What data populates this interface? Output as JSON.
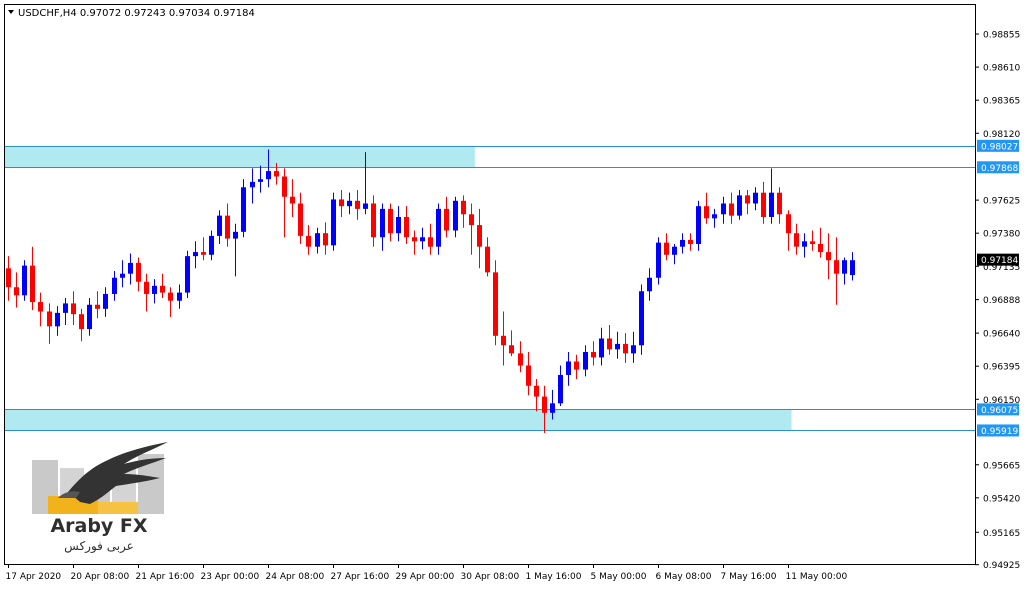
{
  "chart_data": {
    "type": "candlestick",
    "symbol_line": "USDCHF,H4  0.97072 0.97243 0.97034 0.97184",
    "menu_icon": "triangle-down-icon",
    "ylim": [
      0.9493,
      0.9907
    ],
    "y_ticks": [
      "0.98855",
      "0.98610",
      "0.98365",
      "0.98120",
      "0.97625",
      "0.97380",
      "0.97135",
      "0.96888",
      "0.96640",
      "0.96395",
      "0.96150",
      "0.95665",
      "0.95420",
      "0.95165",
      "0.94925"
    ],
    "x_ticks": [
      "17 Apr 2020",
      "20 Apr 08:00",
      "21 Apr 16:00",
      "23 Apr 00:00",
      "24 Apr 08:00",
      "27 Apr 16:00",
      "29 Apr 00:00",
      "30 Apr 08:00",
      "1 May 16:00",
      "5 May 00:00",
      "6 May 08:00",
      "7 May 16:00",
      "11 May 00:00"
    ],
    "x_tick_bar_index": [
      0,
      8,
      16,
      24,
      32,
      40,
      48,
      56,
      64,
      72,
      80,
      88,
      96
    ],
    "grid": false,
    "colors": {
      "bull": "#0000ff",
      "bear": "#ff0000",
      "zone": "#b0eaf0",
      "zone_line": "#2e8fc4",
      "price_label_bg": "#2196f3",
      "current_label_bg": "#000000"
    },
    "zones": [
      {
        "from": 0.97868,
        "to": 0.98027,
        "start_bar": 0,
        "end_bar": 57
      },
      {
        "from": 0.95919,
        "to": 0.96075,
        "start_bar": 0,
        "end_bar": 96
      }
    ],
    "level_labels": [
      {
        "value": 0.98027,
        "label": "0.98027"
      },
      {
        "value": 0.97868,
        "label": "0.97868"
      },
      {
        "value": 0.96075,
        "label": "0.96075"
      },
      {
        "value": 0.95919,
        "label": "0.95919"
      }
    ],
    "current_price": {
      "value": 0.97184,
      "label": "0.97184"
    },
    "candles": [
      [
        0.9712,
        0.9721,
        0.9688,
        0.9698
      ],
      [
        0.9698,
        0.9709,
        0.9683,
        0.9692
      ],
      [
        0.9692,
        0.9718,
        0.9688,
        0.9714
      ],
      [
        0.9714,
        0.9728,
        0.9681,
        0.9687
      ],
      [
        0.9687,
        0.9694,
        0.9669,
        0.968
      ],
      [
        0.968,
        0.9686,
        0.9656,
        0.9669
      ],
      [
        0.9669,
        0.9684,
        0.9662,
        0.9679
      ],
      [
        0.9679,
        0.969,
        0.967,
        0.9686
      ],
      [
        0.9686,
        0.9695,
        0.967,
        0.9678
      ],
      [
        0.9678,
        0.9682,
        0.9658,
        0.9667
      ],
      [
        0.9667,
        0.969,
        0.9662,
        0.9685
      ],
      [
        0.9685,
        0.9695,
        0.9675,
        0.9682
      ],
      [
        0.9682,
        0.9698,
        0.9676,
        0.9693
      ],
      [
        0.9693,
        0.971,
        0.9688,
        0.9705
      ],
      [
        0.9705,
        0.9718,
        0.9698,
        0.9708
      ],
      [
        0.9708,
        0.9723,
        0.97,
        0.9716
      ],
      [
        0.9716,
        0.972,
        0.9695,
        0.9702
      ],
      [
        0.9702,
        0.9708,
        0.968,
        0.9693
      ],
      [
        0.9693,
        0.9704,
        0.9686,
        0.9699
      ],
      [
        0.9699,
        0.9708,
        0.969,
        0.9694
      ],
      [
        0.9694,
        0.9698,
        0.9676,
        0.9688
      ],
      [
        0.9688,
        0.97,
        0.9682,
        0.9694
      ],
      [
        0.9694,
        0.9725,
        0.969,
        0.9721
      ],
      [
        0.9721,
        0.9732,
        0.9712,
        0.9724
      ],
      [
        0.9724,
        0.9735,
        0.9718,
        0.9722
      ],
      [
        0.9722,
        0.974,
        0.9718,
        0.9736
      ],
      [
        0.9736,
        0.9755,
        0.973,
        0.9751
      ],
      [
        0.9751,
        0.976,
        0.9728,
        0.9734
      ],
      [
        0.9734,
        0.9745,
        0.9706,
        0.9739
      ],
      [
        0.9739,
        0.9778,
        0.9735,
        0.9772
      ],
      [
        0.9772,
        0.9786,
        0.976,
        0.9776
      ],
      [
        0.9776,
        0.9788,
        0.9768,
        0.9778
      ],
      [
        0.9778,
        0.98,
        0.9772,
        0.9784
      ],
      [
        0.9784,
        0.979,
        0.9774,
        0.978
      ],
      [
        0.978,
        0.9786,
        0.9735,
        0.9765
      ],
      [
        0.9765,
        0.9778,
        0.975,
        0.976
      ],
      [
        0.976,
        0.9768,
        0.973,
        0.9736
      ],
      [
        0.9736,
        0.9744,
        0.9722,
        0.9728
      ],
      [
        0.9728,
        0.9742,
        0.9723,
        0.9738
      ],
      [
        0.9738,
        0.9746,
        0.9722,
        0.9729
      ],
      [
        0.9729,
        0.9768,
        0.9725,
        0.9763
      ],
      [
        0.9763,
        0.977,
        0.975,
        0.9758
      ],
      [
        0.9758,
        0.9768,
        0.9752,
        0.9762
      ],
      [
        0.9762,
        0.977,
        0.9748,
        0.9756
      ],
      [
        0.9756,
        0.9798,
        0.9752,
        0.976
      ],
      [
        0.976,
        0.9766,
        0.9728,
        0.9735
      ],
      [
        0.9735,
        0.976,
        0.9725,
        0.9756
      ],
      [
        0.9756,
        0.976,
        0.9732,
        0.9738
      ],
      [
        0.9738,
        0.9758,
        0.9732,
        0.975
      ],
      [
        0.975,
        0.9758,
        0.973,
        0.9735
      ],
      [
        0.9735,
        0.974,
        0.9722,
        0.9732
      ],
      [
        0.9732,
        0.9742,
        0.9726,
        0.9735
      ],
      [
        0.9735,
        0.9745,
        0.9722,
        0.9728
      ],
      [
        0.9728,
        0.976,
        0.9722,
        0.9756
      ],
      [
        0.9756,
        0.9765,
        0.9735,
        0.974
      ],
      [
        0.974,
        0.9765,
        0.9735,
        0.9762
      ],
      [
        0.9762,
        0.9766,
        0.9742,
        0.9752
      ],
      [
        0.9752,
        0.976,
        0.9722,
        0.9744
      ],
      [
        0.9744,
        0.9756,
        0.9712,
        0.9728
      ],
      [
        0.9728,
        0.9735,
        0.9706,
        0.9709
      ],
      [
        0.9709,
        0.9718,
        0.9655,
        0.9662
      ],
      [
        0.9662,
        0.968,
        0.964,
        0.9655
      ],
      [
        0.9655,
        0.9666,
        0.9647,
        0.9649
      ],
      [
        0.9649,
        0.9658,
        0.9635,
        0.964
      ],
      [
        0.964,
        0.965,
        0.9618,
        0.9625
      ],
      [
        0.9625,
        0.963,
        0.9606,
        0.9617
      ],
      [
        0.9617,
        0.9625,
        0.959,
        0.9605
      ],
      [
        0.9605,
        0.9622,
        0.96,
        0.9612
      ],
      [
        0.9612,
        0.964,
        0.961,
        0.9633
      ],
      [
        0.9633,
        0.965,
        0.9625,
        0.9643
      ],
      [
        0.9643,
        0.9648,
        0.963,
        0.9637
      ],
      [
        0.9637,
        0.9655,
        0.9632,
        0.965
      ],
      [
        0.965,
        0.9658,
        0.964,
        0.9646
      ],
      [
        0.9646,
        0.9668,
        0.964,
        0.966
      ],
      [
        0.966,
        0.967,
        0.9648,
        0.9652
      ],
      [
        0.9652,
        0.9665,
        0.9645,
        0.9656
      ],
      [
        0.9656,
        0.9664,
        0.9642,
        0.9649
      ],
      [
        0.9649,
        0.9665,
        0.9642,
        0.9655
      ],
      [
        0.9655,
        0.97,
        0.9648,
        0.9695
      ],
      [
        0.9695,
        0.9712,
        0.9688,
        0.9705
      ],
      [
        0.9705,
        0.9735,
        0.97,
        0.9731
      ],
      [
        0.9731,
        0.9738,
        0.9718,
        0.9722
      ],
      [
        0.9722,
        0.973,
        0.9715,
        0.9728
      ],
      [
        0.9728,
        0.9738,
        0.9723,
        0.9733
      ],
      [
        0.9733,
        0.9738,
        0.9725,
        0.973
      ],
      [
        0.973,
        0.9762,
        0.9725,
        0.9758
      ],
      [
        0.9758,
        0.9768,
        0.9745,
        0.9749
      ],
      [
        0.9749,
        0.9756,
        0.9742,
        0.9752
      ],
      [
        0.9752,
        0.9765,
        0.9745,
        0.976
      ],
      [
        0.976,
        0.9768,
        0.9745,
        0.9751
      ],
      [
        0.9751,
        0.977,
        0.9748,
        0.9766
      ],
      [
        0.9766,
        0.977,
        0.9752,
        0.976
      ],
      [
        0.976,
        0.9772,
        0.9755,
        0.9768
      ],
      [
        0.9768,
        0.9776,
        0.9745,
        0.975
      ],
      [
        0.975,
        0.9786,
        0.9745,
        0.9768
      ],
      [
        0.9768,
        0.9772,
        0.9745,
        0.9752
      ],
      [
        0.9752,
        0.9755,
        0.9725,
        0.9738
      ],
      [
        0.9738,
        0.9745,
        0.9722,
        0.9728
      ],
      [
        0.9728,
        0.9738,
        0.972,
        0.9732
      ],
      [
        0.9732,
        0.974,
        0.9725,
        0.973
      ],
      [
        0.973,
        0.9742,
        0.972,
        0.9724
      ],
      [
        0.9724,
        0.9738,
        0.9704,
        0.9718
      ],
      [
        0.9718,
        0.9735,
        0.9685,
        0.9708
      ],
      [
        0.9708,
        0.972,
        0.97,
        0.9718
      ],
      [
        0.9707,
        0.9724,
        0.9703,
        0.9718
      ]
    ]
  },
  "logo": {
    "text_en": "Araby FX",
    "text_ar": "عربى فوركس",
    "icon": "eagle-logo-icon"
  }
}
